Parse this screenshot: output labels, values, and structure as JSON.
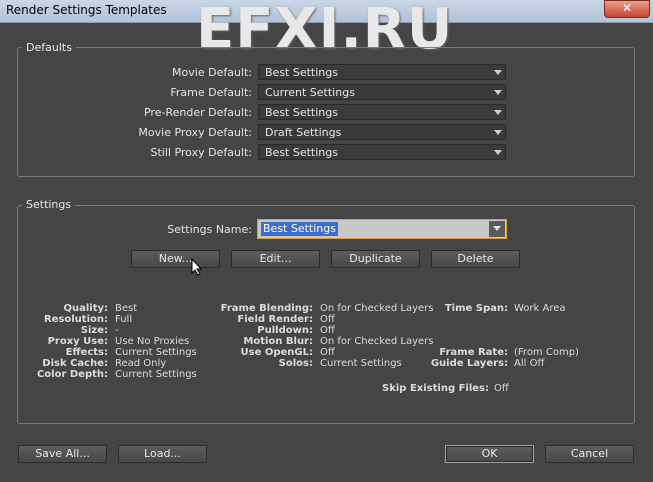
{
  "window": {
    "title": "Render Settings Templates",
    "close_label": "✕"
  },
  "watermark": "EFXI.RU",
  "defaults": {
    "legend": "Defaults",
    "rows": [
      {
        "label": "Movie Default:",
        "value": "Best Settings"
      },
      {
        "label": "Frame Default:",
        "value": "Current Settings"
      },
      {
        "label": "Pre-Render Default:",
        "value": "Best Settings"
      },
      {
        "label": "Movie Proxy Default:",
        "value": "Draft Settings"
      },
      {
        "label": "Still Proxy Default:",
        "value": "Best Settings"
      }
    ]
  },
  "settings": {
    "legend": "Settings",
    "name_label": "Settings Name:",
    "name_value": "Best Settings",
    "buttons": {
      "new": "New...",
      "edit": "Edit...",
      "duplicate": "Duplicate",
      "delete": "Delete"
    },
    "summary": {
      "col1": [
        {
          "label": "Quality:",
          "value": "Best"
        },
        {
          "label": "Resolution:",
          "value": "Full"
        },
        {
          "label": "Size:",
          "value": "-"
        },
        {
          "label": "Proxy Use:",
          "value": "Use No Proxies"
        },
        {
          "label": "Effects:",
          "value": "Current Settings"
        },
        {
          "label": "Disk Cache:",
          "value": "Read Only"
        },
        {
          "label": "Color Depth:",
          "value": "Current Settings"
        }
      ],
      "col2": [
        {
          "label": "Frame Blending:",
          "value": "On for Checked Layers"
        },
        {
          "label": "Field Render:",
          "value": "Off"
        },
        {
          "label": "Pulldown:",
          "value": "Off"
        },
        {
          "label": "Motion Blur:",
          "value": "On for Checked Layers"
        },
        {
          "label": "Use OpenGL:",
          "value": "Off"
        },
        {
          "label": "Solos:",
          "value": "Current Settings"
        }
      ],
      "time_span": {
        "label": "Time Span:",
        "value": "Work Area"
      },
      "frame_rate": {
        "label": "Frame Rate:",
        "value": "(From Comp)"
      },
      "guide_layers": {
        "label": "Guide Layers:",
        "value": "All Off"
      },
      "skip_existing": {
        "label": "Skip Existing Files:",
        "value": "Off"
      }
    }
  },
  "footer": {
    "save_all": "Save All...",
    "load": "Load...",
    "ok": "OK",
    "cancel": "Cancel"
  }
}
